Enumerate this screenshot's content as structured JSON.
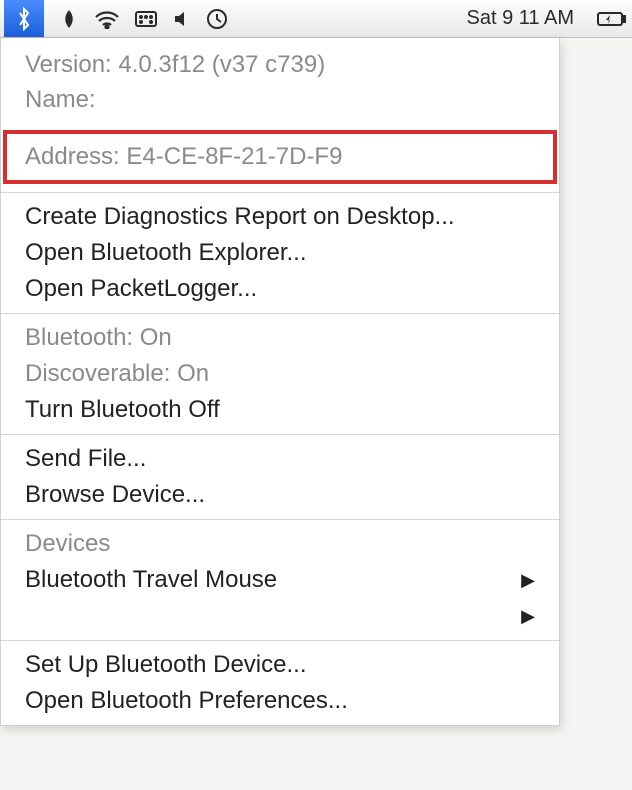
{
  "menubar": {
    "time": "Sat 9 11 AM"
  },
  "info": {
    "version_label": "Version:",
    "version_value": "4.0.3f12 (v37 c739)",
    "name_label": "Name:",
    "name_value": "",
    "address_label": "Address:",
    "address_value": "E4-CE-8F-21-7D-F9"
  },
  "menu": {
    "diag": "Create Diagnostics Report on Desktop...",
    "explorer": "Open Bluetooth Explorer...",
    "packet": "Open PacketLogger...",
    "bt_status_label": "Bluetooth:",
    "bt_status_value": "On",
    "discoverable_label": "Discoverable:",
    "discoverable_value": "On",
    "turn_off": "Turn Bluetooth Off",
    "send_file": "Send File...",
    "browse": "Browse Device...",
    "devices_header": "Devices",
    "device1": "Bluetooth Travel Mouse",
    "setup": "Set Up Bluetooth Device...",
    "prefs": "Open Bluetooth Preferences..."
  }
}
